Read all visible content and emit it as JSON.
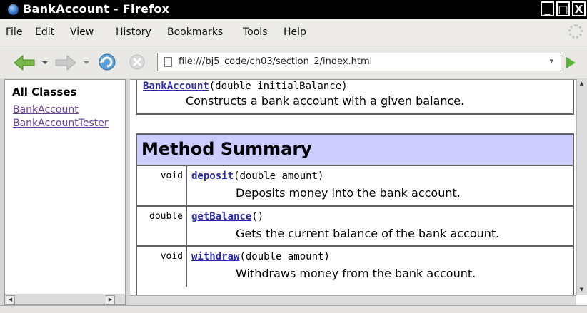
{
  "window": {
    "title": "BankAccount - Firefox",
    "minimize": "_",
    "maximize": "□",
    "close": "X"
  },
  "menu": [
    "File",
    "Edit",
    "View",
    "History",
    "Bookmarks",
    "Tools",
    "Help"
  ],
  "nav": {
    "url": "file:///bj5_code/ch03/section_2/index.html"
  },
  "left_frame": {
    "heading": "All Classes",
    "classes": [
      "BankAccount",
      "BankAccountTester"
    ]
  },
  "constructor": {
    "name": "BankAccount",
    "params": "(double initialBalance)",
    "description": "Constructs a bank account with a given balance."
  },
  "method_summary": {
    "heading": "Method Summary",
    "methods": [
      {
        "type": "void",
        "name": "deposit",
        "params": "(double amount)",
        "description": "Deposits money into the bank account."
      },
      {
        "type": "double",
        "name": "getBalance",
        "params": "()",
        "description": "Gets the current balance of the bank account."
      },
      {
        "type": "void",
        "name": "withdraw",
        "params": "(double amount)",
        "description": "Withdraws money from the bank account."
      }
    ]
  },
  "colors": {
    "header_bg": "#ccccff",
    "link": "#2a2aa8",
    "visited_link": "#6a3fa0"
  }
}
